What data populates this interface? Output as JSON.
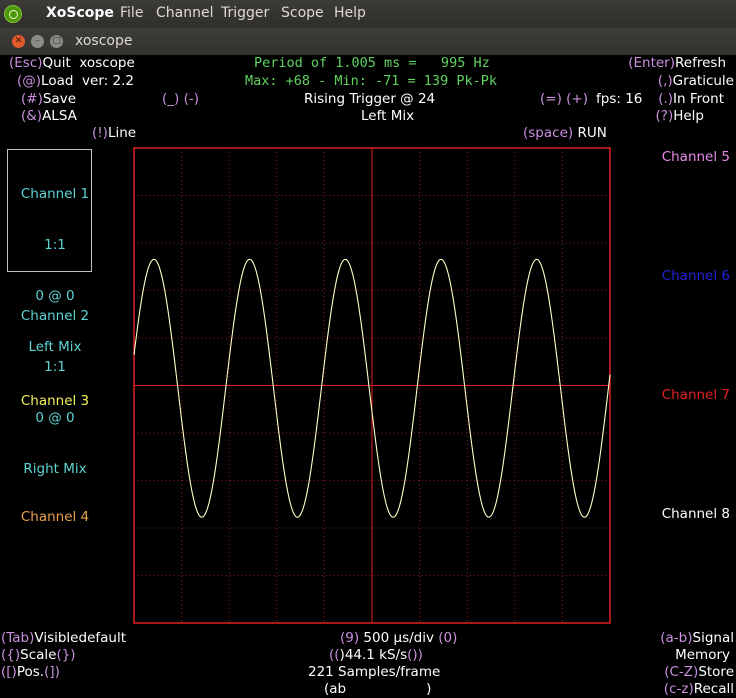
{
  "menubar": {
    "app_name": "XoScope",
    "items": [
      "File",
      "Channel",
      "Trigger",
      "Scope",
      "Help"
    ]
  },
  "window": {
    "title": "xoscope",
    "buttons": [
      "close",
      "minimize",
      "maximize"
    ]
  },
  "top": {
    "quit_key": "(Esc)",
    "quit_label": "Quit",
    "app_label": "xoscope",
    "load_key": "(@)",
    "load_label": "Load",
    "version": "ver: 2.2",
    "save_key": "(#)",
    "save_label": "Save",
    "alsa_key": "(&)",
    "alsa_label": "ALSA",
    "line_key": "(!)",
    "line_label": "Line",
    "period_line": "Period of 1.005 ms =   995 Hz",
    "maxmin_line": "Max: +68 - Min: -71 = 139 Pk-Pk",
    "trig_dec": "(_) (-)",
    "trigger_text": "Rising Trigger @ 24",
    "trig_inc": "(=) (+)",
    "fps": "fps: 16",
    "trigger_source": "Left Mix",
    "run_key": "(space)",
    "run_label": "RUN",
    "refresh_key": "(Enter)",
    "refresh_label": "Refresh",
    "graticule_key": "(,)",
    "graticule_label": "Graticule",
    "front_key": "(.)",
    "front_label": "In Front",
    "help_key": "(?)",
    "help_label": "Help"
  },
  "channels_left": [
    {
      "name": "Channel 1",
      "scale": "1:1",
      "pos": "0 @ 0",
      "source": "Left Mix",
      "color": "#5fd3d3"
    },
    {
      "name": "Channel 2",
      "scale": "1:1",
      "pos": "0 @ 0",
      "source": "Right Mix",
      "color": "#5fd3d3"
    },
    {
      "name": "Channel 3",
      "color": "#f2f25a"
    },
    {
      "name": "Channel 4",
      "color": "#e8a050"
    }
  ],
  "channels_right": [
    {
      "name": "Channel 5",
      "color": "#e88ae8"
    },
    {
      "name": "Channel 6",
      "color": "#2222dd"
    },
    {
      "name": "Channel 7",
      "color": "#e02020"
    },
    {
      "name": "Channel 8",
      "color": "#ffffff"
    }
  ],
  "bottom": {
    "visible_key": "(Tab)",
    "visible_label": "Visible",
    "visible_value": "default",
    "scale_open": "({)",
    "scale_label": "Scale",
    "scale_close": "(})",
    "pos_open": "([)",
    "pos_label": "Pos.",
    "pos_close": "(])",
    "tdiv_dec": "(9)",
    "time_div": "500 µs/div",
    "tdiv_inc": "(0)",
    "rate_open": "((",
    "rate": ")44.1 kS/s",
    "rate_close": "())",
    "samples": "221 Samples/frame",
    "mem_open": "(ab",
    "mem_close": ")",
    "signal_key": "(a-b)",
    "signal_label": "Signal",
    "memory_label": "Memory",
    "store_key": "(C-Z)",
    "store_label": "Store",
    "recall_key": "(c-z)",
    "recall_label": "Recall"
  },
  "colors": {
    "key": "#c98fdc",
    "status_green": "#5fd35f",
    "trace": "#ffffc8",
    "grid_border": "#e02020",
    "grid_dots": "#8a1a1a"
  },
  "chart_data": {
    "type": "line",
    "grid_divisions": [
      10,
      10
    ],
    "time_per_div_us": 500,
    "trace": {
      "period_ms": 1.005,
      "frequency_hz": 995,
      "max": 68,
      "min": -71,
      "peak_to_peak": 139,
      "start_phase_deg": 15
    }
  }
}
